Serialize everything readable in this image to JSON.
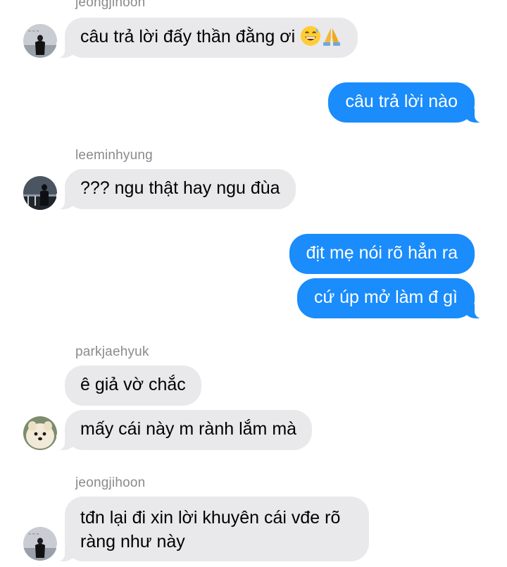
{
  "messages": [
    {
      "type": "sender",
      "text": "jeongjihoon"
    },
    {
      "type": "in",
      "text": "câu trả lời đấy thần đằng ơi",
      "emoji": [
        "grinning-sweat",
        "folded-hands"
      ]
    },
    {
      "type": "out",
      "text": "câu trả lời nào"
    },
    {
      "type": "sender",
      "text": "leeminhyung"
    },
    {
      "type": "in",
      "text": "??? ngu thật hay ngu đùa"
    },
    {
      "type": "out",
      "text": "địt mẹ nói rõ hẳn ra"
    },
    {
      "type": "out",
      "text": "cứ úp mở làm đ gì"
    },
    {
      "type": "sender",
      "text": "parkjaehyuk"
    },
    {
      "type": "in",
      "text": "ê giả vờ chắc"
    },
    {
      "type": "in",
      "text": "mấy cái này m rành lắm mà"
    },
    {
      "type": "sender",
      "text": "jeongjihoon"
    },
    {
      "type": "in",
      "text": "tđn lại đi xin lời khuyên cái vđe rõ ràng như này"
    }
  ],
  "colors": {
    "incoming_bubble": "#e9e9eb",
    "outgoing_bubble": "#1a8cfb",
    "sender_name": "#8a8a8e"
  },
  "icons": [
    "grinning-sweat-emoji",
    "folded-hands-emoji",
    "avatar-jeongjihoon",
    "avatar-leeminhyung",
    "avatar-parkjaehyuk"
  ]
}
